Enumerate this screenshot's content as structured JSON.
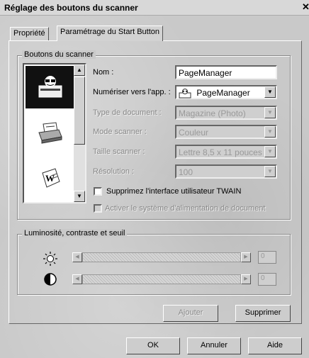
{
  "window": {
    "title": "Réglage des boutons du scanner",
    "close_glyph": "✕"
  },
  "tabs": [
    {
      "label": "Propriété"
    },
    {
      "label": "Paramétrage du Start Button"
    }
  ],
  "scanner_buttons": {
    "group_label": "Boutons du scanner",
    "list_icons": [
      "pagemanager-scanner-icon",
      "printer-icon",
      "word-document-icon"
    ],
    "name_label": "Nom :",
    "name_value": "PageManager",
    "scan_to_label": "Numériser vers l'app. :",
    "scan_to_value": "PageManager",
    "doc_type_label": "Type de document :",
    "doc_type_value": "Magazine (Photo)",
    "scan_mode_label": "Mode scanner :",
    "scan_mode_value": "Couleur",
    "scan_size_label": "Taille scanner :",
    "scan_size_value": "Lettre 8,5 x 11 pouces",
    "resolution_label": "Résolution :",
    "resolution_value": "100",
    "twain_label": "Supprimez l'interface utilisateur TWAIN",
    "feeder_label": "Activer le système d'alimentation de document"
  },
  "brightness": {
    "group_label": "Luminosité, contraste et seuil",
    "brightness_value": "0",
    "contrast_value": "0"
  },
  "actions": {
    "add_label": "Ajouter",
    "delete_label": "Supprimer"
  },
  "footer": {
    "ok_label": "OK",
    "cancel_label": "Annuler",
    "help_label": "Aide"
  }
}
